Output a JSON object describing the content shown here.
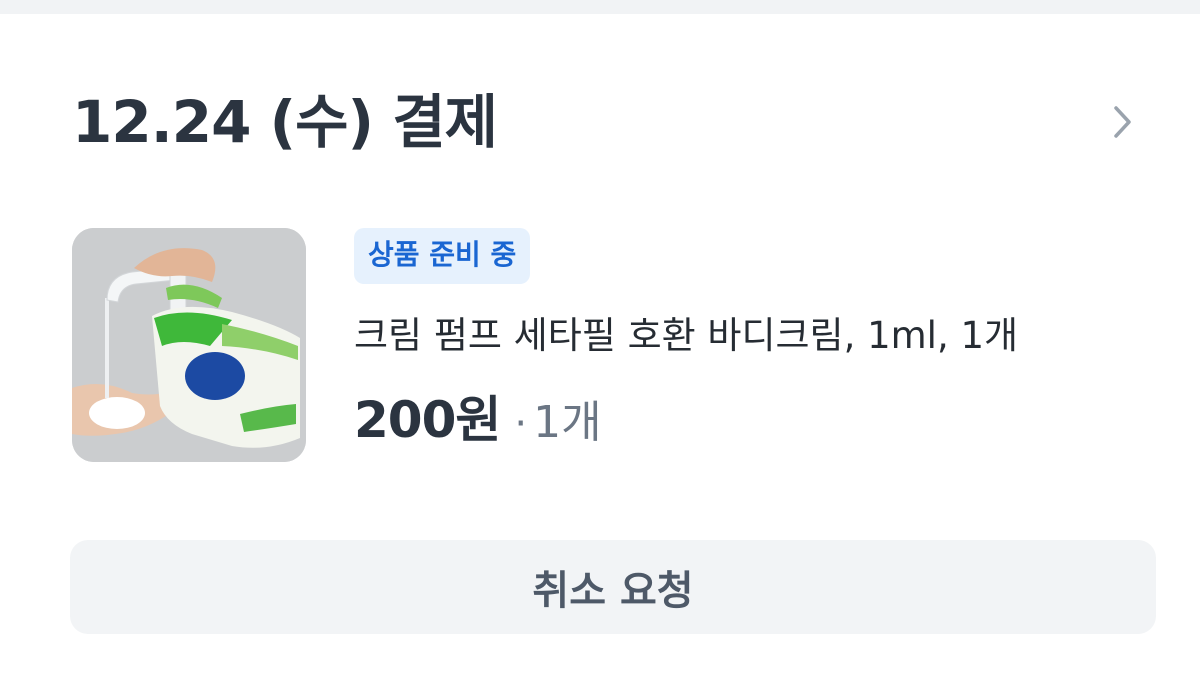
{
  "order": {
    "date_title": "12.24 (수) 결제",
    "detail_chevron_icon": "chevron-right-icon"
  },
  "product": {
    "image_icon": "product-thumbnail",
    "status_badge": "상품 준비 중",
    "name": "크림 펌프 세타필 호환 바디크림, 1ml, 1개",
    "price": "200원",
    "separator": "·",
    "quantity": "1개"
  },
  "actions": {
    "cancel_label": "취소 요청"
  },
  "colors": {
    "badge_bg": "#e6f1fd",
    "badge_text": "#1a66d2",
    "button_bg": "#f2f4f6",
    "title_text": "#2b3440"
  }
}
